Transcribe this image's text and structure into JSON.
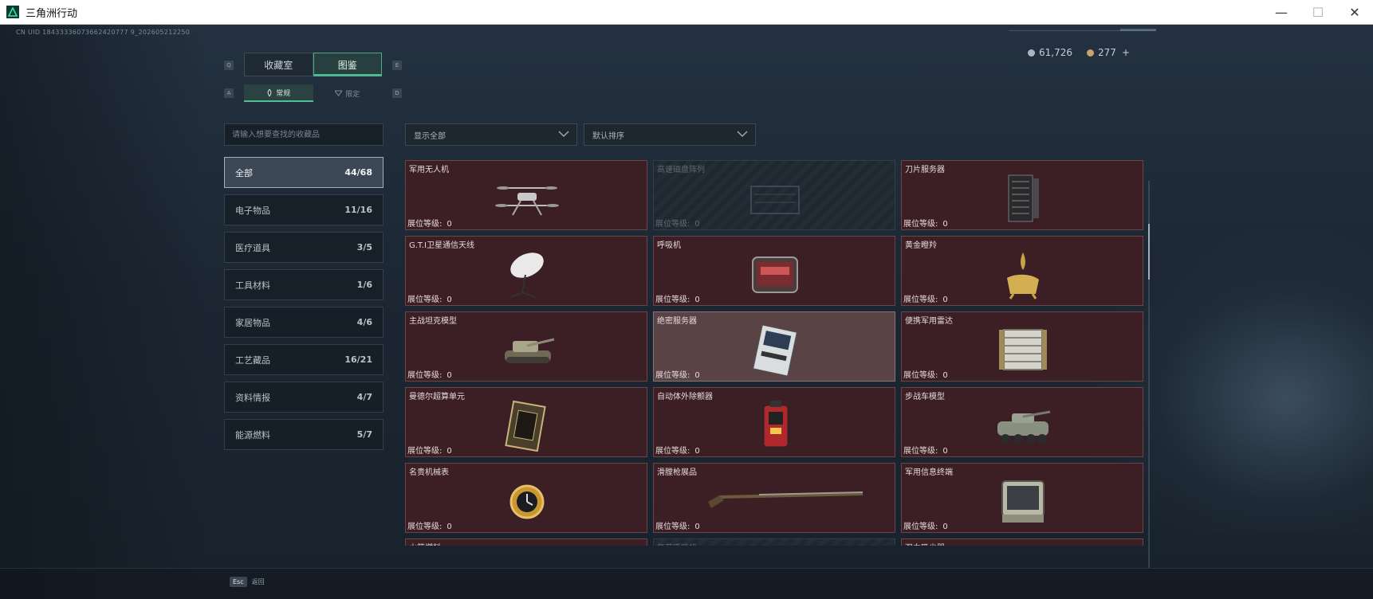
{
  "window": {
    "title": "三角洲行动"
  },
  "uid": "CN UID 18433336073662420777 9_202605212250",
  "currency": {
    "silver": "61,726",
    "gold": "277",
    "plus": "+",
    "silver_color": "#aeb6bd",
    "gold_color": "#c9a46a"
  },
  "tabs": {
    "items": [
      {
        "label": "收藏室",
        "key": "Q"
      },
      {
        "label": "图鉴",
        "key": "E"
      }
    ],
    "active": "图鉴"
  },
  "subtabs": {
    "items": [
      {
        "label": "常规",
        "key": "A"
      },
      {
        "label": "限定",
        "key": "D"
      }
    ],
    "active": "常规"
  },
  "search": {
    "placeholder": "请输入想要查找的收藏品"
  },
  "filters": {
    "display": "显示全部",
    "sort": "默认排序"
  },
  "categories": [
    {
      "label": "全部",
      "count": "44/68"
    },
    {
      "label": "电子物品",
      "count": "11/16"
    },
    {
      "label": "医疗道具",
      "count": "3/5"
    },
    {
      "label": "工具材料",
      "count": "1/6"
    },
    {
      "label": "家居物品",
      "count": "4/6"
    },
    {
      "label": "工艺藏品",
      "count": "16/21"
    },
    {
      "label": "资料情报",
      "count": "4/7"
    },
    {
      "label": "能源燃料",
      "count": "5/7"
    }
  ],
  "level_label": "展位等级:",
  "items": [
    {
      "name": "军用无人机",
      "level": "0",
      "icon": "drone-icon",
      "state": "normal"
    },
    {
      "name": "高速磁盘阵列",
      "level": "0",
      "icon": "disk-array-icon",
      "state": "locked"
    },
    {
      "name": "刀片服务器",
      "level": "0",
      "icon": "blade-server-icon",
      "state": "normal"
    },
    {
      "name": "G.T.I卫星通信天线",
      "level": "0",
      "icon": "satellite-dish-icon",
      "state": "normal"
    },
    {
      "name": "呼吸机",
      "level": "0",
      "icon": "ventilator-icon",
      "state": "normal"
    },
    {
      "name": "黄金瞪羚",
      "level": "0",
      "icon": "gold-gazelle-icon",
      "state": "normal"
    },
    {
      "name": "主战坦克模型",
      "level": "0",
      "icon": "tank-model-icon",
      "state": "normal"
    },
    {
      "name": "绝密服务器",
      "level": "0",
      "icon": "secret-server-icon",
      "state": "highlight"
    },
    {
      "name": "便携军用雷达",
      "level": "0",
      "icon": "radar-icon",
      "state": "normal"
    },
    {
      "name": "曼德尔超算单元",
      "level": "0",
      "icon": "compute-unit-icon",
      "state": "normal"
    },
    {
      "name": "自动体外除颤器",
      "level": "0",
      "icon": "defibrillator-icon",
      "state": "normal"
    },
    {
      "name": "步战车模型",
      "level": "0",
      "icon": "ifv-model-icon",
      "state": "normal"
    },
    {
      "name": "名贵机械表",
      "level": "0",
      "icon": "watch-icon",
      "state": "normal"
    },
    {
      "name": "滑膛枪展品",
      "level": "0",
      "icon": "musket-icon",
      "state": "normal"
    },
    {
      "name": "军用信息终端",
      "level": "0",
      "icon": "terminal-icon",
      "state": "normal"
    },
    {
      "name": "火箭燃料",
      "level": "",
      "icon": "rocket-fuel-icon",
      "state": "normal"
    },
    {
      "name": "复苏呼吸机",
      "level": "",
      "icon": "respirator-icon",
      "state": "locked"
    },
    {
      "name": "强力吸尘器",
      "level": "",
      "icon": "vacuum-icon",
      "state": "normal"
    }
  ],
  "footer": {
    "esc_key": "Esc",
    "esc_label": "返回"
  }
}
